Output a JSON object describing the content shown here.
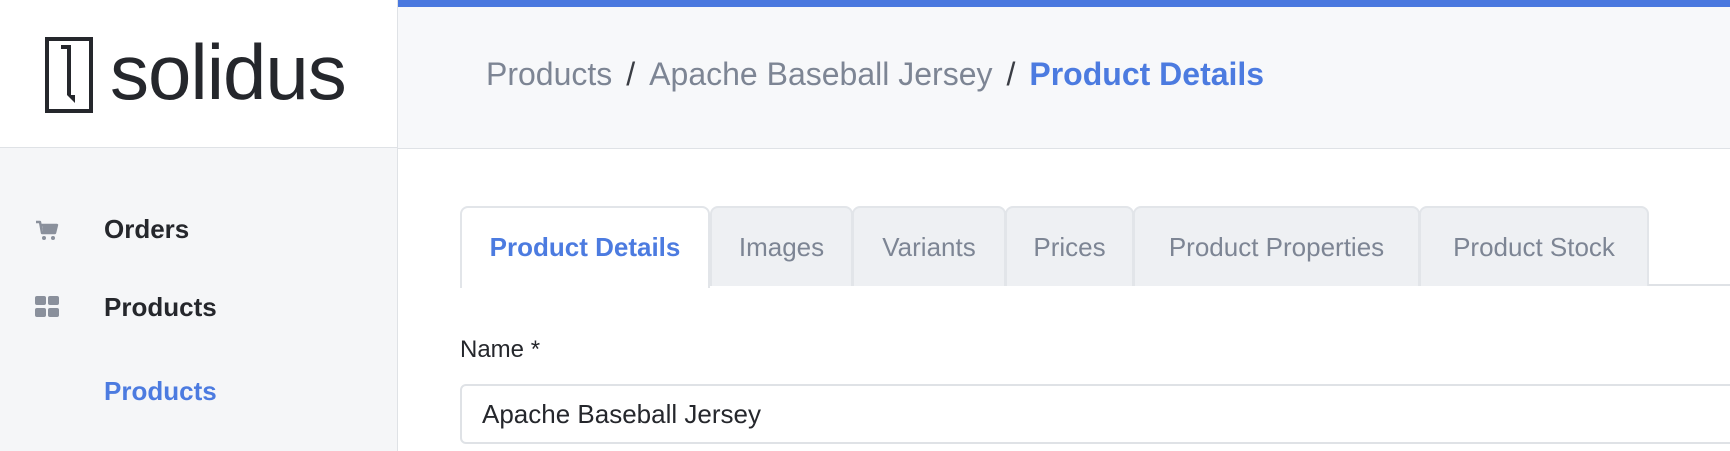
{
  "brand": {
    "name": "solidus",
    "logo_icon": "solidus-logo-mark"
  },
  "sidebar": {
    "items": [
      {
        "label": "Orders",
        "icon": "cart-icon"
      },
      {
        "label": "Products",
        "icon": "grid-icon"
      }
    ],
    "sub_items": [
      {
        "label": "Products",
        "active": true
      }
    ]
  },
  "breadcrumb": {
    "items": [
      "Products",
      "Apache Baseball Jersey"
    ],
    "current": "Product Details",
    "separator": "/"
  },
  "tabs": [
    {
      "label": "Product Details",
      "active": true
    },
    {
      "label": "Images",
      "active": false
    },
    {
      "label": "Variants",
      "active": false
    },
    {
      "label": "Prices",
      "active": false
    },
    {
      "label": "Product Properties",
      "active": false
    },
    {
      "label": "Product Stock",
      "active": false
    }
  ],
  "form": {
    "name_label": "Name *",
    "name_value": "Apache Baseball Jersey"
  },
  "colors": {
    "accent": "#4a78df",
    "link_active": "#4c7be0",
    "muted_text": "#7d8594",
    "sidebar_bg": "#f5f6f8"
  }
}
